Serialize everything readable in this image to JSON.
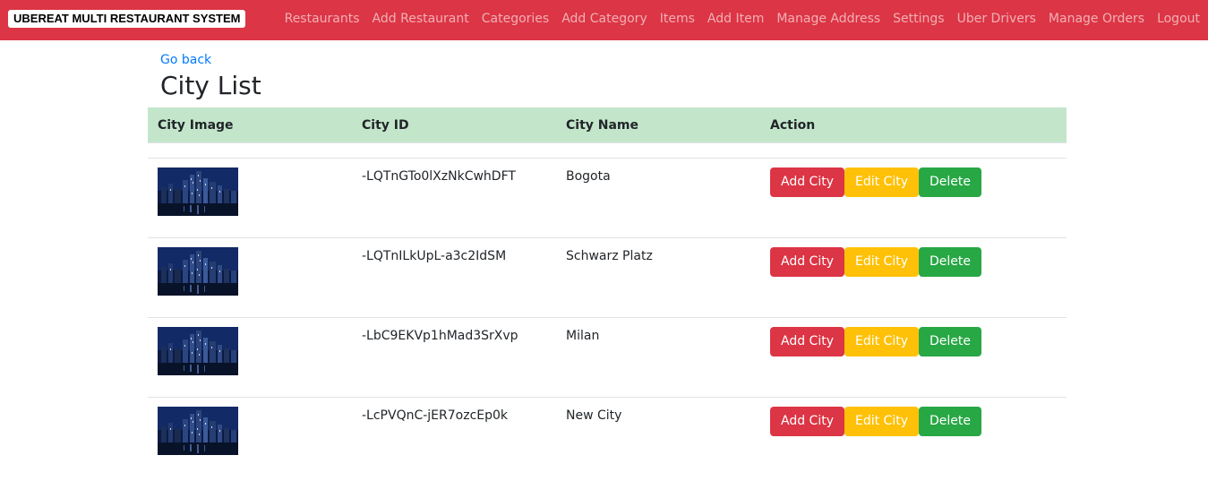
{
  "navbar": {
    "brand": "UBEREAT MULTI RESTAURANT SYSTEM",
    "links": [
      "Restaurants",
      "Add Restaurant",
      "Categories",
      "Add Category",
      "Items",
      "Add Item",
      "Manage Address",
      "Settings",
      "Uber Drivers",
      "Manage Orders",
      "Logout"
    ],
    "color": "#dc3545"
  },
  "page": {
    "go_back": "Go back",
    "title": "City List"
  },
  "table": {
    "headers": [
      "City Image",
      "City ID",
      "City Name",
      "Action"
    ],
    "header_color": "#c3e6cb",
    "rows": [
      {
        "id": "-LQTnGTo0lXzNkCwhDFT",
        "name": "Bogota"
      },
      {
        "id": "-LQTnILkUpL-a3c2IdSM",
        "name": "Schwarz Platz"
      },
      {
        "id": "-LbC9EKVp1hMad3SrXvp",
        "name": "Milan"
      },
      {
        "id": "-LcPVQnC-jER7ozcEp0k",
        "name": "New City"
      }
    ],
    "actions": {
      "add": "Add City",
      "edit": "Edit City",
      "delete": "Delete"
    }
  }
}
